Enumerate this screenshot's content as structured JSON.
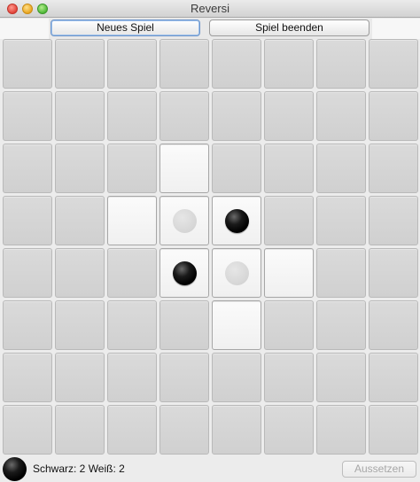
{
  "window": {
    "title": "Reversi"
  },
  "toolbar": {
    "new_game_label": "Neues Spiel",
    "quit_game_label": "Spiel beenden"
  },
  "board": {
    "rows": 8,
    "cols": 8,
    "pieces": [
      {
        "row": 3,
        "col": 3,
        "color": "white"
      },
      {
        "row": 3,
        "col": 4,
        "color": "black"
      },
      {
        "row": 4,
        "col": 3,
        "color": "black"
      },
      {
        "row": 4,
        "col": 4,
        "color": "white"
      }
    ],
    "valid_moves": [
      {
        "row": 2,
        "col": 3
      },
      {
        "row": 3,
        "col": 2
      },
      {
        "row": 4,
        "col": 5
      },
      {
        "row": 5,
        "col": 4
      }
    ]
  },
  "status": {
    "current_player": "black",
    "score_text": "Schwarz: 2 Weiß: 2",
    "pass_label": "Aussetzen",
    "pass_enabled": false
  },
  "colors": {
    "cell": "#d4d4d4",
    "cell_highlight": "#f5f5f5",
    "black_piece": "#000000",
    "white_piece": "#d8d8d8"
  }
}
